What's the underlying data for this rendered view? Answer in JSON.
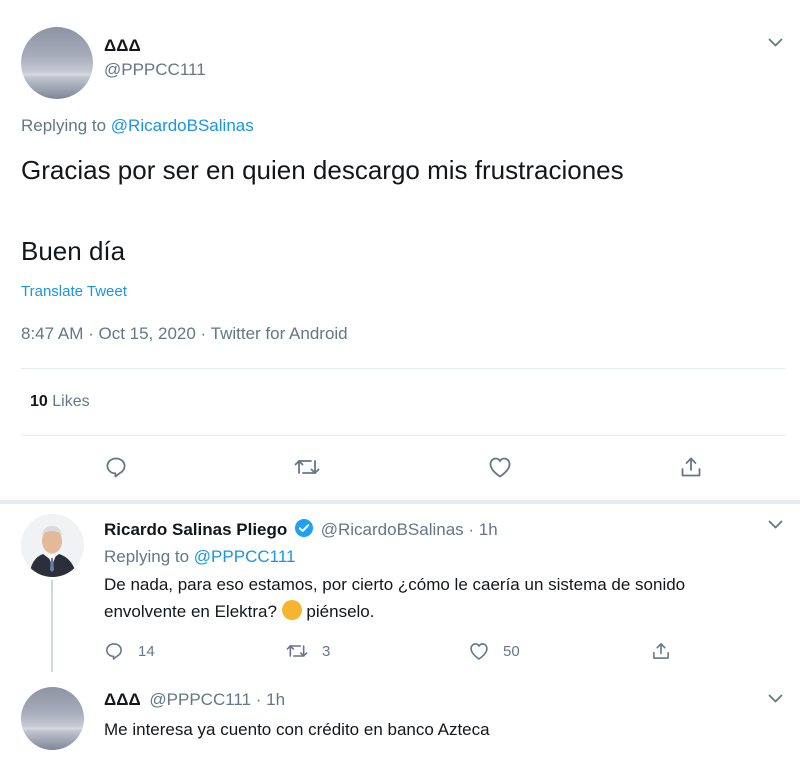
{
  "main_tweet": {
    "display_name": "ΔΔΔ",
    "handle": "@PPPCC111",
    "replying_prefix": "Replying to",
    "replying_to": "@RicardoBSalinas",
    "text_line1": "Gracias por ser en quien descargo mis frustraciones",
    "text_line2": "Buen día",
    "translate": "Translate Tweet",
    "timestamp": "8:47 AM · Oct 15, 2020 · Twitter for Android",
    "likes_count": "10",
    "likes_label": "Likes"
  },
  "reply": {
    "display_name": "Ricardo Salinas Pliego",
    "handle": "@RicardoBSalinas",
    "time": "· 1h",
    "replying_prefix": "Replying to",
    "replying_to": "@PPPCC111",
    "text_line1": "De nada, para eso estamos, por cierto ¿cómo le caería un sistema de sonido",
    "text_line2a": "envolvente en Elektra?",
    "emoji": "🤔",
    "text_line2b": "piénselo.",
    "reply_count": "14",
    "retweet_count": "3",
    "like_count": "50"
  },
  "reply2": {
    "display_name": "ΔΔΔ",
    "handle": "@PPPCC111",
    "time": "· 1h",
    "text": "Me interesa ya cuento con crédito en banco Azteca"
  },
  "colors": {
    "accent": "#1b95e0",
    "muted": "#657786",
    "verified": "#1da1f2",
    "thinking_emoji": "#f5b52e"
  }
}
